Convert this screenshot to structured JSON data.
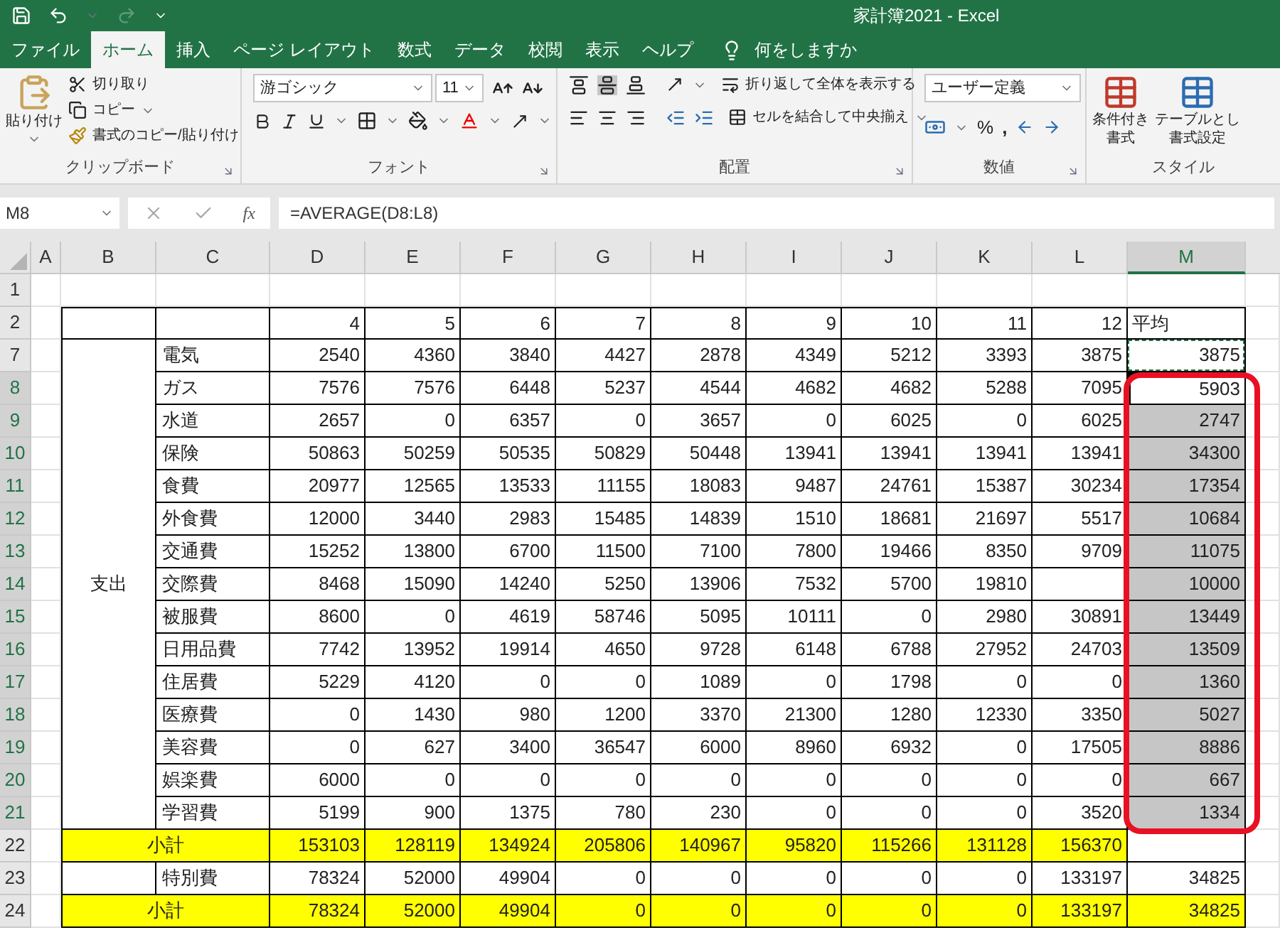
{
  "title_bar": {
    "title": "家計簿2021 - Excel"
  },
  "tabs": [
    {
      "label": "ファイル",
      "selected": false
    },
    {
      "label": "ホーム",
      "selected": true
    },
    {
      "label": "挿入",
      "selected": false
    },
    {
      "label": "ページ レイアウト",
      "selected": false
    },
    {
      "label": "数式",
      "selected": false
    },
    {
      "label": "データ",
      "selected": false
    },
    {
      "label": "校閲",
      "selected": false
    },
    {
      "label": "表示",
      "selected": false
    },
    {
      "label": "ヘルプ",
      "selected": false
    }
  ],
  "tell_me": "何をしますか",
  "ribbon": {
    "clipboard": {
      "label": "クリップボード",
      "paste": "貼り付け",
      "cut": "切り取り",
      "copy": "コピー",
      "format_painter": "書式のコピー/貼り付け"
    },
    "font": {
      "label": "フォント",
      "font_name": "游ゴシック",
      "font_size": "11"
    },
    "alignment": {
      "label": "配置",
      "wrap": "折り返して全体を表示する",
      "merge": "セルを結合して中央揃え"
    },
    "number": {
      "label": "数値",
      "format": "ユーザー定義",
      "percent": "%",
      "comma": ","
    },
    "styles": {
      "label": "スタイル",
      "conditional": [
        "条件付き",
        "書式"
      ],
      "table": [
        "テーブルとし",
        "書式設定"
      ]
    }
  },
  "formula_bar": {
    "name_box": "M8",
    "fx": "fx",
    "formula": "=AVERAGE(D8:L8)"
  },
  "sheet": {
    "columns": [
      {
        "label": "A",
        "selected": false
      },
      {
        "label": "B",
        "selected": false
      },
      {
        "label": "C",
        "selected": false
      },
      {
        "label": "D",
        "selected": false
      },
      {
        "label": "E",
        "selected": false
      },
      {
        "label": "F",
        "selected": false
      },
      {
        "label": "G",
        "selected": false
      },
      {
        "label": "H",
        "selected": false
      },
      {
        "label": "I",
        "selected": false
      },
      {
        "label": "J",
        "selected": false
      },
      {
        "label": "K",
        "selected": false
      },
      {
        "label": "L",
        "selected": false
      },
      {
        "label": "M",
        "selected": true
      }
    ],
    "rows": [
      {
        "number": "1",
        "kind": "blank",
        "selected": false,
        "active": false,
        "copied": false
      },
      {
        "number": "2",
        "kind": "header",
        "selected": false,
        "active": false,
        "copied": false,
        "values": [
          "4",
          "5",
          "6",
          "7",
          "8",
          "9",
          "10",
          "11",
          "12"
        ],
        "average": "平均"
      },
      {
        "kind": "group",
        "label": "支出",
        "rows": [
          {
            "number": "7",
            "kind": "item",
            "selected": false,
            "active": false,
            "copied": true,
            "label": "電気",
            "values": [
              "2540",
              "4360",
              "3840",
              "4427",
              "2878",
              "4349",
              "5212",
              "3393",
              "3875"
            ],
            "average": "3875"
          },
          {
            "number": "8",
            "kind": "item",
            "selected": true,
            "active": true,
            "copied": false,
            "label": "ガス",
            "values": [
              "7576",
              "7576",
              "6448",
              "5237",
              "4544",
              "4682",
              "4682",
              "5288",
              "7095"
            ],
            "average": "5903"
          },
          {
            "number": "9",
            "kind": "item",
            "selected": true,
            "active": false,
            "copied": false,
            "label": "水道",
            "values": [
              "2657",
              "0",
              "6357",
              "0",
              "3657",
              "0",
              "6025",
              "0",
              "6025"
            ],
            "average": "2747"
          },
          {
            "number": "10",
            "kind": "item",
            "selected": true,
            "active": false,
            "copied": false,
            "label": "保険",
            "values": [
              "50863",
              "50259",
              "50535",
              "50829",
              "50448",
              "13941",
              "13941",
              "13941",
              "13941"
            ],
            "average": "34300"
          },
          {
            "number": "11",
            "kind": "item",
            "selected": true,
            "active": false,
            "copied": false,
            "label": "食費",
            "values": [
              "20977",
              "12565",
              "13533",
              "11155",
              "18083",
              "9487",
              "24761",
              "15387",
              "30234"
            ],
            "average": "17354"
          },
          {
            "number": "12",
            "kind": "item",
            "selected": true,
            "active": false,
            "copied": false,
            "label": "外食費",
            "values": [
              "12000",
              "3440",
              "2983",
              "15485",
              "14839",
              "1510",
              "18681",
              "21697",
              "5517"
            ],
            "average": "10684"
          },
          {
            "number": "13",
            "kind": "item",
            "selected": true,
            "active": false,
            "copied": false,
            "label": "交通費",
            "values": [
              "15252",
              "13800",
              "6700",
              "11500",
              "7100",
              "7800",
              "19466",
              "8350",
              "9709"
            ],
            "average": "11075"
          },
          {
            "number": "14",
            "kind": "item",
            "selected": true,
            "active": false,
            "copied": false,
            "label": "交際費",
            "values": [
              "8468",
              "15090",
              "14240",
              "5250",
              "13906",
              "7532",
              "5700",
              "19810"
            ],
            "average": "10000"
          },
          {
            "number": "15",
            "kind": "item",
            "selected": true,
            "active": false,
            "copied": false,
            "label": "被服費",
            "values": [
              "8600",
              "0",
              "4619",
              "58746",
              "5095",
              "10111",
              "0",
              "2980",
              "30891"
            ],
            "average": "13449"
          },
          {
            "number": "16",
            "kind": "item",
            "selected": true,
            "active": false,
            "copied": false,
            "label": "日用品費",
            "values": [
              "7742",
              "13952",
              "19914",
              "4650",
              "9728",
              "6148",
              "6788",
              "27952",
              "24703"
            ],
            "average": "13509"
          },
          {
            "number": "17",
            "kind": "item",
            "selected": true,
            "active": false,
            "copied": false,
            "label": "住居費",
            "values": [
              "5229",
              "4120",
              "0",
              "0",
              "1089",
              "0",
              "1798",
              "0",
              "0"
            ],
            "average": "1360"
          },
          {
            "number": "18",
            "kind": "item",
            "selected": true,
            "active": false,
            "copied": false,
            "label": "医療費",
            "values": [
              "0",
              "1430",
              "980",
              "1200",
              "3370",
              "21300",
              "1280",
              "12330",
              "3350"
            ],
            "average": "5027"
          },
          {
            "number": "19",
            "kind": "item",
            "selected": true,
            "active": false,
            "copied": false,
            "label": "美容費",
            "values": [
              "0",
              "627",
              "3400",
              "36547",
              "6000",
              "8960",
              "6932",
              "0",
              "17505"
            ],
            "average": "8886"
          },
          {
            "number": "20",
            "kind": "item",
            "selected": true,
            "active": false,
            "copied": false,
            "label": "娯楽費",
            "values": [
              "6000",
              "0",
              "0",
              "0",
              "0",
              "0",
              "0",
              "0",
              "0"
            ],
            "average": "667"
          },
          {
            "number": "21",
            "kind": "item",
            "selected": true,
            "active": false,
            "copied": false,
            "label": "学習費",
            "values": [
              "5199",
              "900",
              "1375",
              "780",
              "230",
              "0",
              "0",
              "0",
              "3520"
            ],
            "average": "1334"
          }
        ]
      },
      {
        "number": "22",
        "kind": "subtotal",
        "selected": false,
        "active": false,
        "copied": false,
        "label": "小計",
        "values": [
          "153103",
          "128119",
          "134924",
          "205806",
          "140967",
          "95820",
          "115266",
          "131128",
          "156370"
        ],
        "average": null
      },
      {
        "number": "23",
        "kind": "item",
        "selected": false,
        "active": false,
        "copied": false,
        "label": "特別費",
        "values": [
          "78324",
          "52000",
          "49904",
          "0",
          "0",
          "0",
          "0",
          "0",
          "133197"
        ],
        "average": "34825"
      },
      {
        "number": "24",
        "kind": "subtotal",
        "selected": false,
        "active": false,
        "copied": false,
        "label": "小計",
        "values": [
          "78324",
          "52000",
          "49904",
          "0",
          "0",
          "0",
          "0",
          "0",
          "133197"
        ],
        "average": "34825"
      }
    ]
  }
}
